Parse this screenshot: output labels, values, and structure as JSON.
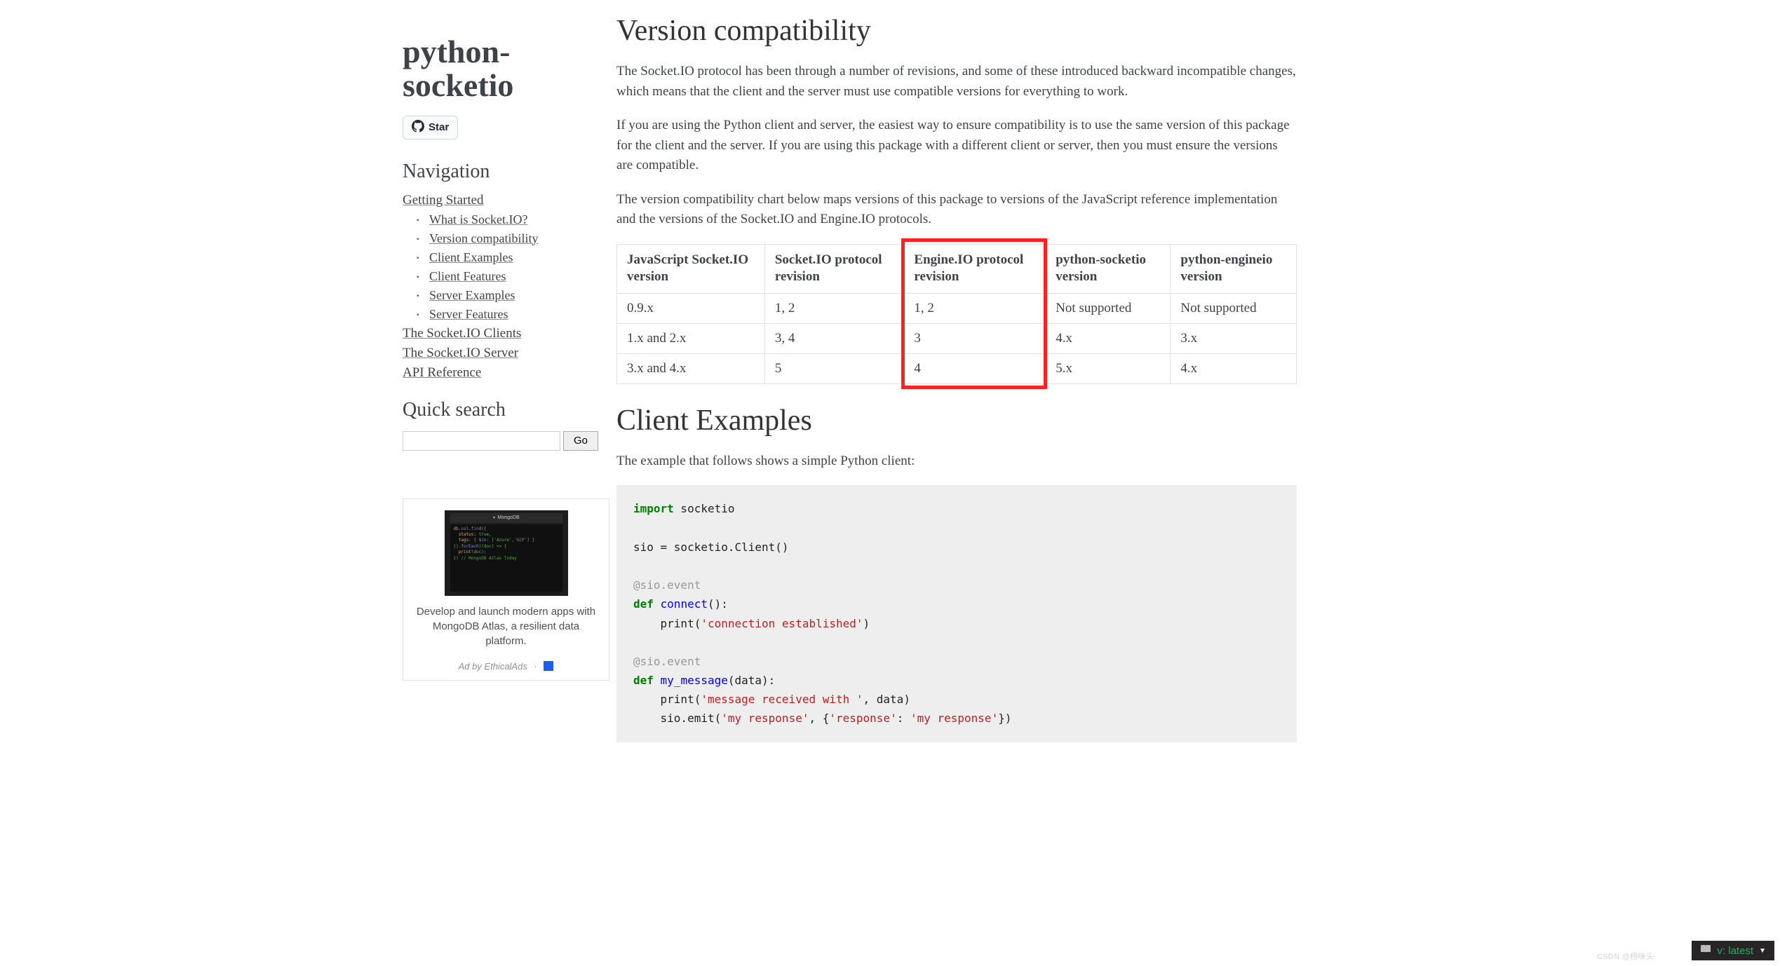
{
  "sidebar": {
    "project_title": "python-socketio",
    "star_label": "Star",
    "nav_heading": "Navigation",
    "nav_top": [
      {
        "label": "Getting Started"
      }
    ],
    "nav_sub": [
      {
        "label": "What is Socket.IO?"
      },
      {
        "label": "Version compatibility"
      },
      {
        "label": "Client Examples"
      },
      {
        "label": "Client Features"
      },
      {
        "label": "Server Examples"
      },
      {
        "label": "Server Features"
      }
    ],
    "nav_after": [
      {
        "label": "The Socket.IO Clients"
      },
      {
        "label": "The Socket.IO Server"
      },
      {
        "label": "API Reference"
      }
    ],
    "search_heading": "Quick search",
    "go_label": "Go",
    "ad_head": "MongoDB",
    "ad_text": "Develop and launch modern apps with MongoDB Atlas, a resilient data platform.",
    "ad_by": "Ad by EthicalAds"
  },
  "main": {
    "h1a": "Version compatibility",
    "p1": "The Socket.IO protocol has been through a number of revisions, and some of these introduced backward incompatible changes, which means that the client and the server must use compatible versions for everything to work.",
    "p2": "If you are using the Python client and server, the easiest way to ensure compatibility is to use the same version of this package for the client and the server. If you are using this package with a different client or server, then you must ensure the versions are compatible.",
    "p3": "The version compatibility chart below maps versions of this package to versions of the JavaScript reference implementation and the versions of the Socket.IO and Engine.IO protocols.",
    "table": {
      "headers": [
        "JavaScript Socket.IO version",
        "Socket.IO protocol revision",
        "Engine.IO protocol revision",
        "python-socketio version",
        "python-engineio version"
      ],
      "rows": [
        [
          "0.9.x",
          "1, 2",
          "1, 2",
          "Not supported",
          "Not supported"
        ],
        [
          "1.x and 2.x",
          "3, 4",
          "3",
          "4.x",
          "3.x"
        ],
        [
          "3.x and 4.x",
          "5",
          "4",
          "5.x",
          "4.x"
        ]
      ]
    },
    "h1b": "Client Examples",
    "p4": "The example that follows shows a simple Python client:"
  },
  "code": {
    "l1_kw": "import",
    "l1_rest": " socketio",
    "l3": "sio = socketio.Client()",
    "l5_dec": "@sio.event",
    "l6_kw": "def",
    "l6_fn": " connect",
    "l6_rest": "():",
    "l7a": "    print(",
    "l7_str": "'connection established'",
    "l7b": ")",
    "l9_dec": "@sio.event",
    "l10_kw": "def",
    "l10_fn": " my_message",
    "l10_rest": "(data):",
    "l11a": "    print(",
    "l11_str": "'message received with '",
    "l11b": ", data)",
    "l12a": "    sio.emit(",
    "l12_str1": "'my response'",
    "l12_mid": ", {",
    "l12_str2": "'response'",
    "l12_colon": ": ",
    "l12_str3": "'my response'",
    "l12_end": "})"
  },
  "version_badge": "v: latest",
  "watermark": "CSDN @杨咪头"
}
